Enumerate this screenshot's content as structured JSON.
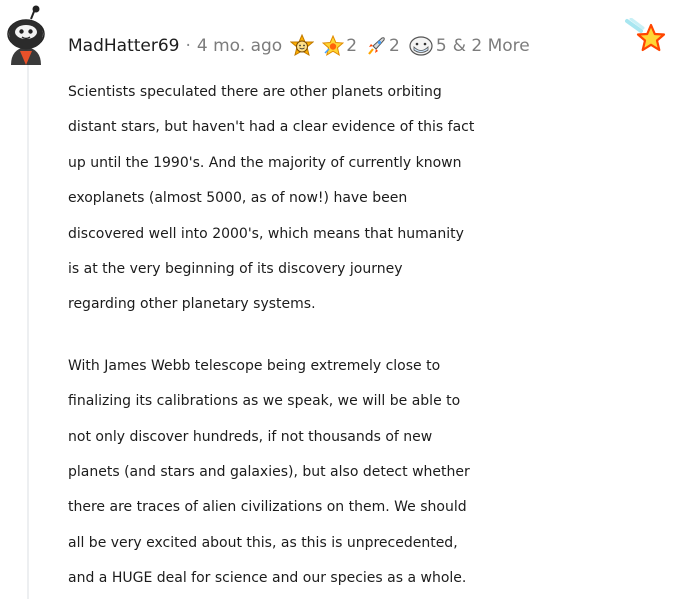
{
  "comment": {
    "username": "MadHatter69",
    "separator": "·",
    "timestamp": "4 mo. ago",
    "awards": [
      {
        "icon": "wholesome-award-icon",
        "count": ""
      },
      {
        "icon": "star-struck-award-icon",
        "count": "2"
      },
      {
        "icon": "rocket-award-icon",
        "count": "2"
      },
      {
        "icon": "wearing-is-caring-award-icon",
        "count": "5"
      }
    ],
    "more_awards": "& 2 More",
    "give_award_icon": "give-award-icon",
    "paragraphs": [
      {
        "lines": [
          "Scientists speculated there are other planets orbiting",
          "distant stars, but haven't had a clear evidence of this fact",
          "up until the 1990's. And the majority of currently known",
          "exoplanets (almost 5000, as of now!) have been",
          "discovered well into 2000's, which means that humanity",
          "is at the very beginning of its discovery journey",
          "regarding other planetary systems."
        ]
      },
      {
        "lines": [
          "With James Webb telescope being extremely close to",
          "finalizing its calibrations as we speak, we will be able to",
          "not only discover hundreds, if not thousands of new",
          "planets (and stars and galaxies), but also detect whether",
          "there are traces of alien civilizations on them. We should",
          "all be very excited about this, as this is unprecedented,",
          "and a HUGE deal for science and our species as a whole."
        ]
      }
    ]
  },
  "colors": {
    "text": "#1c1c1c",
    "meta": "#7c7c7c",
    "thread_line": "#edeff1",
    "award_orange": "#ff8717",
    "award_gold": "#ffd635"
  }
}
